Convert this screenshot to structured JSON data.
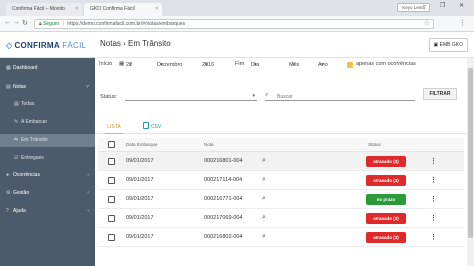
{
  "browser": {
    "tabs": [
      {
        "label": "Confirma Fácil – Monito"
      },
      {
        "label": "GKO Confirma Fácil"
      }
    ],
    "profile_label": "Keyo Lema",
    "window_buttons": "– ❐ ✕",
    "url_secure": "Seguro",
    "url": "https://demo.confirmafacil.com.br/#/notas/embarques"
  },
  "header": {
    "logo_mark": "◇",
    "logo_main": "CONFIRMA",
    "logo_sub": "FÁCIL",
    "page_title": "Notas › Em Trânsito",
    "company_button": "EMB GKO"
  },
  "sidebar": {
    "items": [
      {
        "label": "Dashboard",
        "icon": "▦"
      },
      {
        "label": "Notas",
        "icon": "▤",
        "chevron": "˅"
      },
      {
        "label": "Todas",
        "icon": "▤"
      },
      {
        "label": "A Embarcar",
        "icon": "✎"
      },
      {
        "label": "Em Trânsito",
        "icon": "⇆"
      },
      {
        "label": "Entregues",
        "icon": "☑"
      },
      {
        "label": "Ocorrências",
        "icon": "●",
        "chevron": "‹"
      },
      {
        "label": "Gestão",
        "icon": "⚙",
        "chevron": "‹"
      },
      {
        "label": "Ajuda",
        "icon": "?",
        "chevron": "‹"
      }
    ]
  },
  "filters": {
    "inicio_label": "Início",
    "day_icon": "▦",
    "day": "22",
    "month": "Dezembro",
    "year": "2016",
    "fim_label": "Fim",
    "fim_day": "Dia",
    "fim_month": "Mês",
    "fim_year": "Ano",
    "apenas_label": "apenas com ocorrências",
    "status_label": "Status:",
    "search_placeholder": "Buscar",
    "filter_button": "FILTRAR"
  },
  "tabs": {
    "lista": "LISTA",
    "csv": "CSV"
  },
  "table": {
    "headers": {
      "date": "Data Embarque",
      "nota": "Nota",
      "status": "Status"
    },
    "rows": [
      {
        "date": "09/01/2017",
        "nota": "000216801-004",
        "status": "atrasado (3)",
        "kind": "late"
      },
      {
        "date": "09/01/2017",
        "nota": "000217114-004",
        "status": "atrasado (3)",
        "kind": "late"
      },
      {
        "date": "09/01/2017",
        "nota": "000216771-004",
        "status": "no prazo",
        "kind": "ok"
      },
      {
        "date": "09/01/2017",
        "nota": "000217069-004",
        "status": "atrasado (3)",
        "kind": "late"
      },
      {
        "date": "09/01/2017",
        "nota": "000216802-004",
        "status": "atrasado (3)",
        "kind": "late"
      }
    ]
  },
  "colors": {
    "sidebar": "#4b5b6b",
    "late": "#e0292a",
    "ok": "#2b9b3a",
    "accent": "#e0b847"
  }
}
